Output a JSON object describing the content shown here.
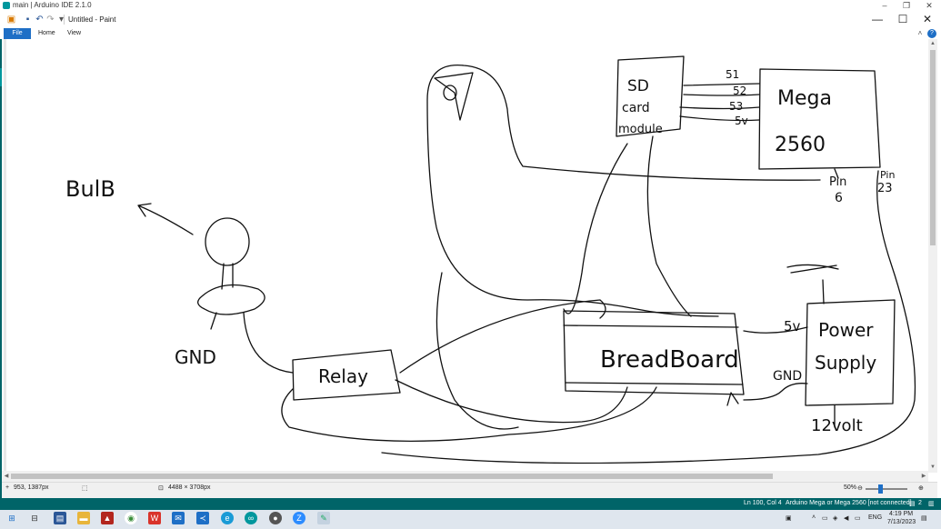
{
  "outer_window": {
    "title": "main | Arduino IDE 2.1.0",
    "controls": {
      "minimize": "–",
      "restore": "❐",
      "close": "✕"
    }
  },
  "paint_window": {
    "title": "Untitled - Paint",
    "controls": {
      "minimize": "—",
      "maximize": "☐",
      "close": "✕"
    },
    "quick_access_icons": [
      "paint-app-icon",
      "save-icon",
      "undo-icon",
      "redo-icon",
      "customize-dropdown-icon"
    ]
  },
  "ribbon": {
    "tabs": [
      {
        "label": "File",
        "active": true
      },
      {
        "label": "Home",
        "active": false
      },
      {
        "label": "View",
        "active": false
      }
    ],
    "collapse_icon": "˄",
    "help_icon": "?"
  },
  "drawing_labels": {
    "sd_top": "SD",
    "sd_mid": "card",
    "sd_bottom": "module",
    "pin_51": "51",
    "pin_52": "52",
    "pin_53": "53",
    "pin_5v_top": "5v",
    "mega_line1": "Mega",
    "mega_line2": "2560",
    "pin6_a": "Pin",
    "pin6_b": "6",
    "pin23_a": "Pin",
    "pin23_b": "23",
    "bulb": "BulB",
    "gnd_left": "GND",
    "relay": "Relay",
    "breadboard": "BreadBoard",
    "ps_5v": "5v",
    "ps_gnd": "GND",
    "power_line1": "Power",
    "power_line2": "Supply",
    "volts": "12volt"
  },
  "paint_status": {
    "cursor_pos": "953, 1387px",
    "selection_icon": "selection-icon",
    "canvas_size": "4488 × 3708px",
    "zoom": "50%",
    "zoom_level": 0.3
  },
  "arduino_status": {
    "cursor": "Ln 100, Col 4",
    "board": "Arduino Mega or Mega 2560 [not connected]",
    "notifications": "2"
  },
  "taskbar": {
    "apps": [
      "start-icon",
      "task-view-icon",
      "store-icon",
      "file-explorer-icon",
      "app-icon",
      "chrome-icon",
      "wps-icon",
      "mail-icon",
      "vscode-icon",
      "edge-icon",
      "arduino-icon",
      "camera-icon",
      "zoom-icon",
      "paint-icon"
    ],
    "tray_lang": "ENG",
    "time": "4:19 PM",
    "date": "7/13/2023"
  },
  "colors": {
    "arduino_teal": "#006468",
    "accent_blue": "#1e6fc6"
  }
}
